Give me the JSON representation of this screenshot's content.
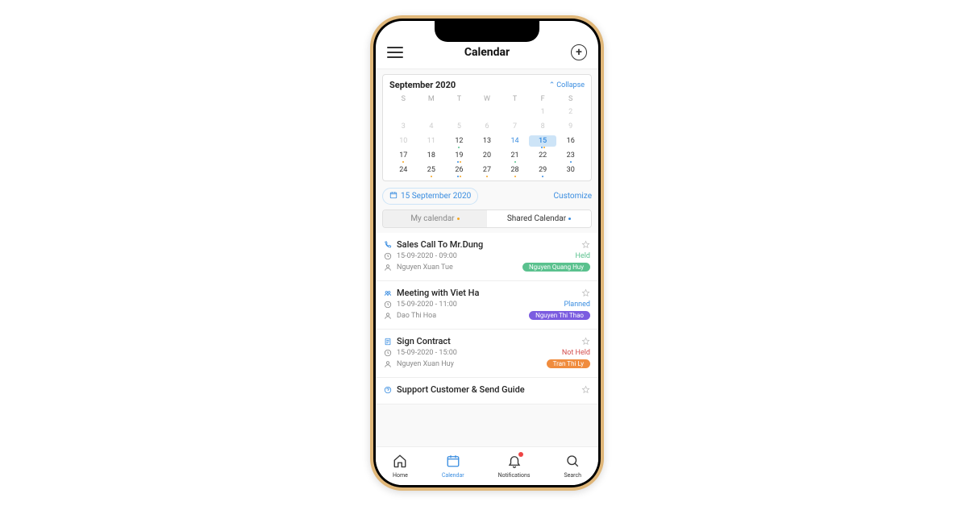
{
  "header": {
    "title": "Calendar"
  },
  "calendar": {
    "month": "September 2020",
    "collapse": "Collapse",
    "dow": [
      "S",
      "M",
      "T",
      "W",
      "T",
      "F",
      "S"
    ],
    "weeks": [
      [
        {
          "d": "",
          "o": true
        },
        {
          "d": "",
          "o": true
        },
        {
          "d": "",
          "o": true
        },
        {
          "d": "",
          "o": true
        },
        {
          "d": "",
          "o": true
        },
        {
          "d": "1",
          "o": true
        },
        {
          "d": "2",
          "o": true
        }
      ],
      [
        {
          "d": "3",
          "o": true
        },
        {
          "d": "4",
          "o": true
        },
        {
          "d": "5",
          "o": true
        },
        {
          "d": "6",
          "o": true
        },
        {
          "d": "7",
          "o": true
        },
        {
          "d": "8",
          "o": true
        },
        {
          "d": "9",
          "o": true
        }
      ],
      [
        {
          "d": "10",
          "o": true
        },
        {
          "d": "11",
          "o": true
        },
        {
          "d": "12",
          "dots": [
            "g"
          ]
        },
        {
          "d": "13"
        },
        {
          "d": "14",
          "blue": true
        },
        {
          "d": "15",
          "sel": true,
          "dots": [
            "b",
            "o"
          ]
        },
        {
          "d": "16"
        }
      ],
      [
        {
          "d": "17",
          "dots": [
            "o"
          ]
        },
        {
          "d": "18"
        },
        {
          "d": "19",
          "dots": [
            "b",
            "o"
          ]
        },
        {
          "d": "20"
        },
        {
          "d": "21",
          "dots": [
            "g"
          ]
        },
        {
          "d": "22"
        },
        {
          "d": "23",
          "dots": [
            "b"
          ]
        }
      ],
      [
        {
          "d": "24"
        },
        {
          "d": "25",
          "dots": [
            "o"
          ]
        },
        {
          "d": "26",
          "dots": [
            "b",
            "o"
          ]
        },
        {
          "d": "27",
          "dots": [
            "o"
          ]
        },
        {
          "d": "28",
          "dots": [
            "o"
          ]
        },
        {
          "d": "29",
          "dots": [
            "b"
          ]
        },
        {
          "d": "30"
        }
      ]
    ]
  },
  "controls": {
    "date": "15 September 2020",
    "customize": "Customize",
    "seg": {
      "my": "My calendar",
      "shared": "Shared Calendar"
    }
  },
  "events": [
    {
      "icon": "phone",
      "title": "Sales Call To Mr.Dung",
      "time": "15-09-2020 - 09:00",
      "status": "Held",
      "statusClass": "status-held",
      "person": "Nguyen Xuan Tue",
      "pill": "Nguyen Quang Huy",
      "pillClass": "green"
    },
    {
      "icon": "meeting",
      "title": "Meeting with Viet Ha",
      "time": "15-09-2020 - 11:00",
      "status": "Planned",
      "statusClass": "status-planned",
      "person": "Dao Thi Hoa",
      "pill": "Nguyen Thi Thao",
      "pillClass": "purple"
    },
    {
      "icon": "contract",
      "title": "Sign Contract",
      "time": "15-09-2020 - 15:00",
      "status": "Not Held",
      "statusClass": "status-notheld",
      "person": "Nguyen Xuan Huy",
      "pill": "Tran Thi Ly",
      "pillClass": "orange"
    },
    {
      "icon": "support",
      "title": "Support Customer & Send Guide",
      "partial": true
    }
  ],
  "tabs": [
    {
      "id": "home",
      "label": "Home"
    },
    {
      "id": "calendar",
      "label": "Calendar",
      "active": true
    },
    {
      "id": "notifications",
      "label": "Notifications",
      "badge": true
    },
    {
      "id": "search",
      "label": "Search"
    }
  ]
}
